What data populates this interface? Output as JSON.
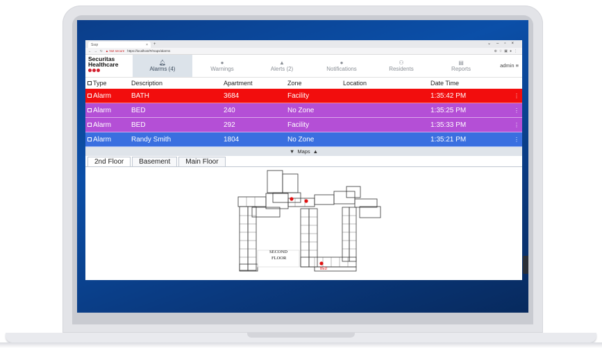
{
  "browser": {
    "tab_title": "Ssqr",
    "new_tab": "+",
    "address_not_secure": "Not secure",
    "address_url": "https://localhost/#/maps/alarms"
  },
  "app": {
    "brand_line1": "Securitas",
    "brand_line2": "Healthcare",
    "user": "admin",
    "nav": [
      {
        "label": "Alarms (4)",
        "icon": "bell-icon",
        "active": true
      },
      {
        "label": "Warnings",
        "icon": "info-icon",
        "active": false
      },
      {
        "label": "Alerts (2)",
        "icon": "warning-triangle-icon",
        "active": false
      },
      {
        "label": "Notifications",
        "icon": "info-icon",
        "active": false
      },
      {
        "label": "Residents",
        "icon": "people-icon",
        "active": false
      },
      {
        "label": "Reports",
        "icon": "document-icon",
        "active": false
      }
    ]
  },
  "table": {
    "headers": [
      "Type",
      "Description",
      "Apartment",
      "Zone",
      "Location",
      "Date Time"
    ],
    "rows": [
      {
        "type": "Alarm",
        "description": "BATH",
        "apartment": "3684",
        "zone": "Facility",
        "location": "",
        "time": "1:35:42 PM",
        "color": "#f20d0d"
      },
      {
        "type": "Alarm",
        "description": "BED",
        "apartment": "240",
        "zone": "No Zone",
        "location": "",
        "time": "1:35:25 PM",
        "color": "#b44fd6"
      },
      {
        "type": "Alarm",
        "description": "BED",
        "apartment": "292",
        "zone": "Facility",
        "location": "",
        "time": "1:35:33 PM",
        "color": "#b44fd6"
      },
      {
        "type": "Alarm",
        "description": "Randy Smith",
        "apartment": "1804",
        "zone": "No Zone",
        "location": "",
        "time": "1:35:21 PM",
        "color": "#3a6fe0"
      }
    ]
  },
  "maps": {
    "toggle_label": "Maps",
    "floors": [
      "2nd Floor",
      "Basement",
      "Main Floor"
    ],
    "active_floor": 0,
    "map_label_1": "SECOND",
    "map_label_2": "FLOOR",
    "marker_label": "BED"
  },
  "colors": {
    "alarm_red": "#f20d0d",
    "alarm_purple": "#b44fd6",
    "alarm_blue": "#3a6fe0",
    "brand_red": "#d21f2e"
  }
}
